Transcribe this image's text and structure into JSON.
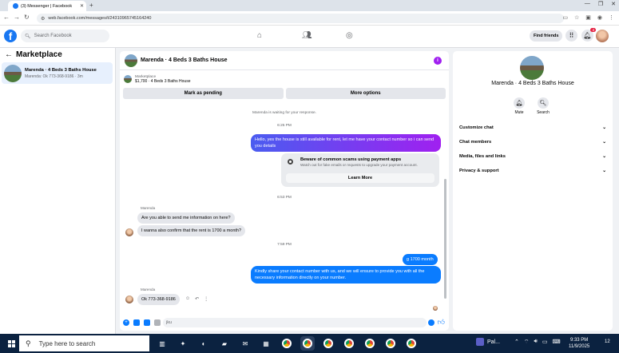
{
  "browser": {
    "tab_title": "(3) Messenger | Facebook",
    "tab_close": "✕",
    "new_tab": "+",
    "url": "web.facebook.com/messages/t/24310965745164240",
    "window_controls": [
      "—",
      "❐",
      "✕"
    ]
  },
  "fb_nav": {
    "logo": "f",
    "search_placeholder": "Search Facebook",
    "find_friends": "Find friends",
    "notif_badge": "3"
  },
  "sidebar": {
    "title": "Marketplace",
    "items": [
      {
        "name": "Marenda · 4 Beds 3 Baths House",
        "preview": "Marenda: Ok 773-368-9186 · 3m"
      }
    ]
  },
  "chat": {
    "header_name": "Marenda · 4 Beds 3 Baths House",
    "listing_label": "Marketplace",
    "listing_detail": "$1,700 · 4 Beds 3 Baths House",
    "mark_pending": "Mark as pending",
    "more_options": "More options",
    "waiting_note": "Marenda is waiting for your response.",
    "time1": "6:25 PM",
    "out_msg1": "Hello, yes the house is still available for rent, let me have your contact number so i can send you  details",
    "scam_title": "Beware of common scams using payment apps",
    "scam_sub": "Watch out for fake emails or requests to upgrade your payment account.",
    "learn_more": "Learn More",
    "time2": "6:53 PM",
    "sender1": "Marenda",
    "in_msg1": "Are you able to send me information on here?",
    "in_msg2": "I wanna also confirm that the rent is 1700 a month?",
    "time3": "7:59 PM",
    "out_msg2": "g 1700 month",
    "out_msg3": "Kindly share your contact number with us, and we will ensure to provide you with all the necessary information directly on your number.",
    "sender2": "Marenda",
    "in_msg3": "Ok 773-368-9186",
    "composer_text": "jku"
  },
  "rpanel": {
    "name": "Marenda · 4 Beds 3 Baths House",
    "mute": "Mute",
    "search": "Search",
    "sections": [
      "Customize chat",
      "Chat members",
      "Media, files and links",
      "Privacy & support"
    ]
  },
  "taskbar": {
    "search_placeholder": "Type here to search",
    "pal_label": "Pal...",
    "time": "9:33 PM",
    "date": "11/9/2025",
    "notif_count": "12"
  }
}
